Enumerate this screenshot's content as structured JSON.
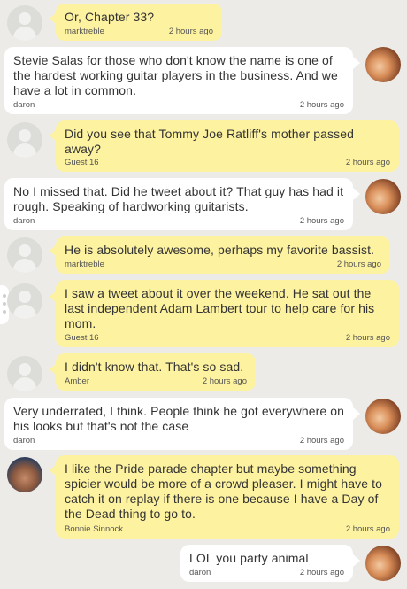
{
  "messages": [
    {
      "text": "Or, Chapter 33?",
      "author": "marktreble",
      "time": "2 hours ago"
    },
    {
      "text": "Stevie Salas for those who don't know the name is one of the hardest working guitar players in the business. And we have a lot in common.",
      "author": "daron",
      "time": "2 hours ago"
    },
    {
      "text": "Did you see that Tommy Joe Ratliff's mother passed away?",
      "author": "Guest 16",
      "time": "2 hours ago"
    },
    {
      "text": "No I missed that. Did he tweet about it? That guy has had it rough. Speaking of hardworking guitarists.",
      "author": "daron",
      "time": "2 hours ago"
    },
    {
      "text": "He is absolutely awesome, perhaps my favorite bassist.",
      "author": "marktreble",
      "time": "2 hours ago"
    },
    {
      "text": "I saw a tweet about it over the weekend. He sat out the last independent Adam Lambert tour to help care for his mom.",
      "author": "Guest 16",
      "time": "2 hours ago"
    },
    {
      "text": "I didn't know that. That's so sad.",
      "author": "Amber",
      "time": "2 hours ago"
    },
    {
      "text": "Very underrated, I think. People think he got everywhere on his looks but that's not the case",
      "author": "daron",
      "time": "2 hours ago"
    },
    {
      "text": "I like the Pride parade chapter but maybe something spicier would be more of a crowd pleaser. I might have to catch it on replay if there is one because I have a Day of the Dead thing to go to.",
      "author": "Bonnie Sinnock",
      "time": "2 hours ago"
    },
    {
      "text": "LOL you party animal",
      "author": "daron",
      "time": "2 hours ago"
    }
  ]
}
